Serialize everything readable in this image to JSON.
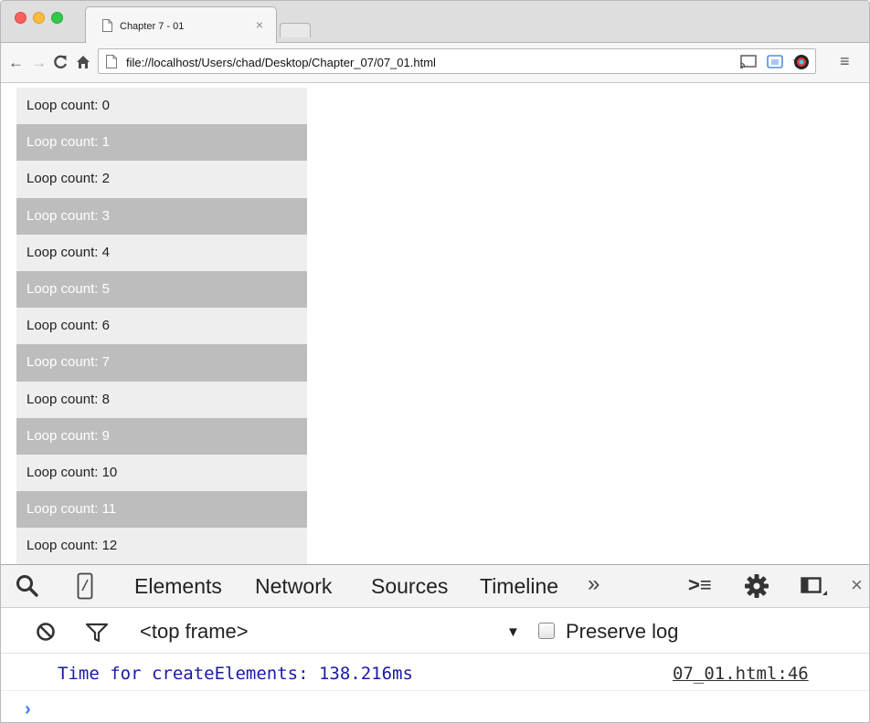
{
  "browser": {
    "tab_title": "Chapter 7 - 01",
    "tab_close": "×",
    "url": "file://localhost/Users/chad/Desktop/Chapter_07/07_01.html",
    "menu_icon": "≡"
  },
  "page": {
    "loop_items": [
      "Loop count: 0",
      "Loop count: 1",
      "Loop count: 2",
      "Loop count: 3",
      "Loop count: 4",
      "Loop count: 5",
      "Loop count: 6",
      "Loop count: 7",
      "Loop count: 8",
      "Loop count: 9",
      "Loop count: 10",
      "Loop count: 11",
      "Loop count: 12"
    ],
    "colors": {
      "even_row": "#eeeeee",
      "odd_row": "#bdbdbd"
    }
  },
  "devtools": {
    "tabs": [
      "Elements",
      "Network",
      "Sources",
      "Timeline"
    ],
    "more": "»",
    "close": "×",
    "frame_select": "<top frame>",
    "preserve_log": "Preserve log",
    "console": {
      "message": "Time for createElements: 138.216ms",
      "source": "07_01.html:46",
      "prompt": "›"
    }
  }
}
